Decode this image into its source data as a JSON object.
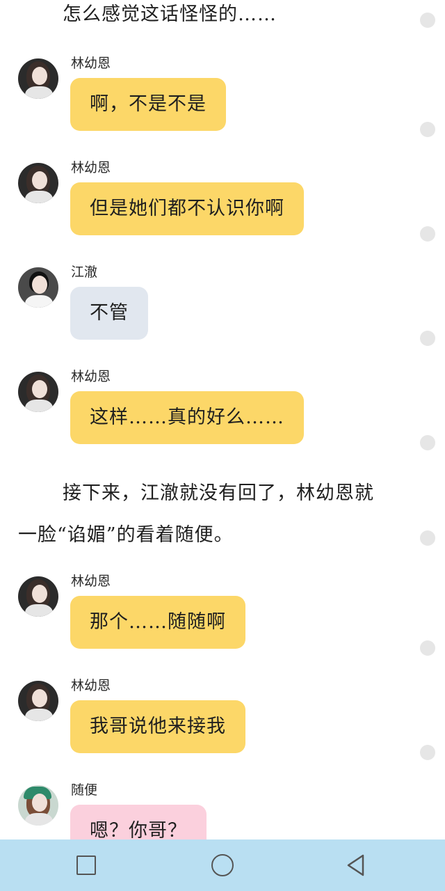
{
  "narration": {
    "top": "怎么感觉这话怪怪的……",
    "p1": "接下来，江澈就没有回了，林幼恩就",
    "p2": "一脸“谄媚”的看着随便。"
  },
  "messages": [
    {
      "name": "林幼恩",
      "text": "啊，不是不是",
      "bubble_color": "#fcd768"
    },
    {
      "name": "林幼恩",
      "text": "但是她们都不认识你啊",
      "bubble_color": "#fcd768"
    },
    {
      "name": "江澈",
      "text": "不管",
      "bubble_color": "#e1e7ef"
    },
    {
      "name": "林幼恩",
      "text": "这样……真的好么……",
      "bubble_color": "#fcd768"
    },
    {
      "name": "林幼恩",
      "text": "那个……随随啊",
      "bubble_color": "#fcd768"
    },
    {
      "name": "林幼恩",
      "text": "我哥说他来接我",
      "bubble_color": "#fcd768"
    },
    {
      "name": "随便",
      "text": "嗯？你哥？",
      "bubble_color": "#fbd0dd"
    }
  ],
  "navbar": {
    "background": "#b9dff2",
    "buttons": [
      "square-recent-apps-icon",
      "circle-home-icon",
      "triangle-back-icon"
    ]
  }
}
